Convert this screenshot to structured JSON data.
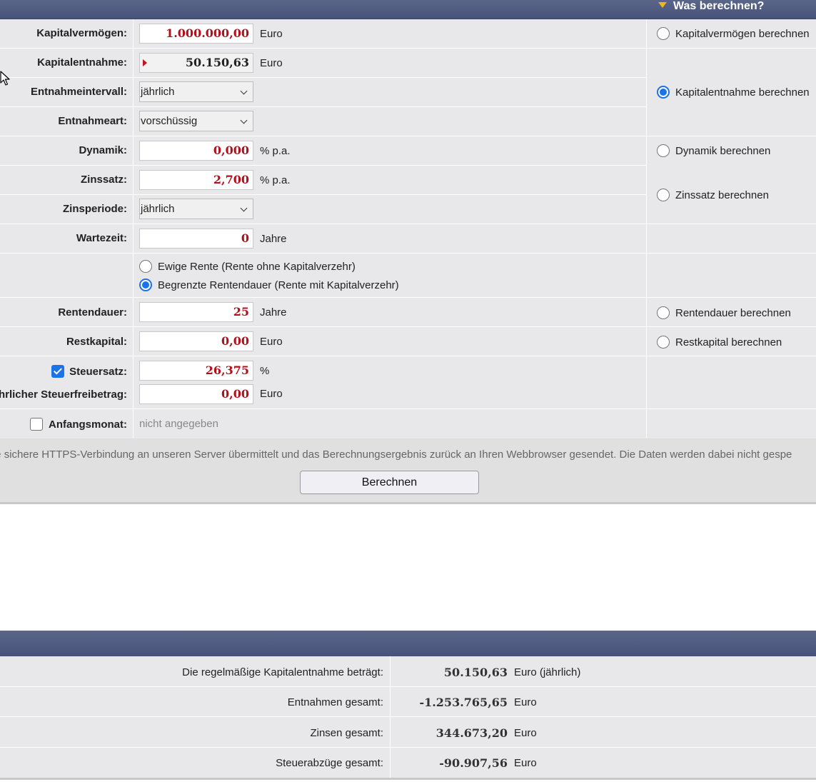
{
  "header": {
    "title": "Was berechnen?"
  },
  "fields": {
    "kapitalvermoegen": {
      "label": "Kapitalvermögen:",
      "value": "1.000.000,00",
      "unit": "Euro"
    },
    "kapitalentnahme": {
      "label": "Kapitalentnahme:",
      "value": "50.150,63",
      "unit": "Euro"
    },
    "entnahmeintervall": {
      "label": "Entnahmeintervall:",
      "selected": "jährlich"
    },
    "entnahmeart": {
      "label": "Entnahmeart:",
      "selected": "vorschüssig"
    },
    "dynamik": {
      "label": "Dynamik:",
      "value": "0,000",
      "unit": "% p.a."
    },
    "zinssatz": {
      "label": "Zinssatz:",
      "value": "2,700",
      "unit": "% p.a."
    },
    "zinsperiode": {
      "label": "Zinsperiode:",
      "selected": "jährlich"
    },
    "wartezeit": {
      "label": "Wartezeit:",
      "value": "0",
      "unit": "Jahre"
    },
    "rentenart": {
      "options": [
        "Ewige Rente (Rente ohne Kapitalverzehr)",
        "Begrenzte Rentendauer (Rente mit Kapitalverzehr)"
      ],
      "selected_index": 1
    },
    "rentendauer": {
      "label": "Rentendauer:",
      "value": "25",
      "unit": "Jahre"
    },
    "restkapital": {
      "label": "Restkapital:",
      "value": "0,00",
      "unit": "Euro"
    },
    "steuersatz": {
      "label": "Steuersatz:",
      "checked": true,
      "value": "26,375",
      "unit": "%"
    },
    "steuerfreibetrag": {
      "label": "hrlicher Steuerfreibetrag:",
      "value": "0,00",
      "unit": "Euro"
    },
    "anfangsmonat": {
      "label": "Anfangsmonat:",
      "checked": false,
      "value": "nicht angegeben"
    }
  },
  "calc_options": {
    "kapitalvermoegen": "Kapitalvermögen berechnen",
    "kapitalentnahme": "Kapitalentnahme berechnen",
    "dynamik": "Dynamik berechnen",
    "zinssatz": "Zinssatz berechnen",
    "rentendauer": "Rentendauer berechnen",
    "restkapital": "Restkapital berechnen",
    "selected": "kapitalentnahme"
  },
  "info_text": "r eine sichere HTTPS-Verbindung an unseren Server übermittelt und das Berechnungsergebnis zurück an Ihren Webbrowser gesendet. Die Daten werden dabei nicht gespe",
  "submit_label": "Berechnen",
  "results": [
    {
      "label": "Die regelmäßige Kapitalentnahme beträgt:",
      "value": "50.150,63",
      "unit": "Euro (jährlich)"
    },
    {
      "label": "Entnahmen gesamt:",
      "value": "-1.253.765,65",
      "unit": "Euro"
    },
    {
      "label": "Zinsen gesamt:",
      "value": "344.673,20",
      "unit": "Euro"
    },
    {
      "label": "Steuerabzüge gesamt:",
      "value": "-90.907,56",
      "unit": "Euro"
    }
  ],
  "colors": {
    "header": "#4f5b80",
    "accent": "#f0b422",
    "input_value": "#b0101a",
    "radio_selected": "#1a73e8"
  }
}
